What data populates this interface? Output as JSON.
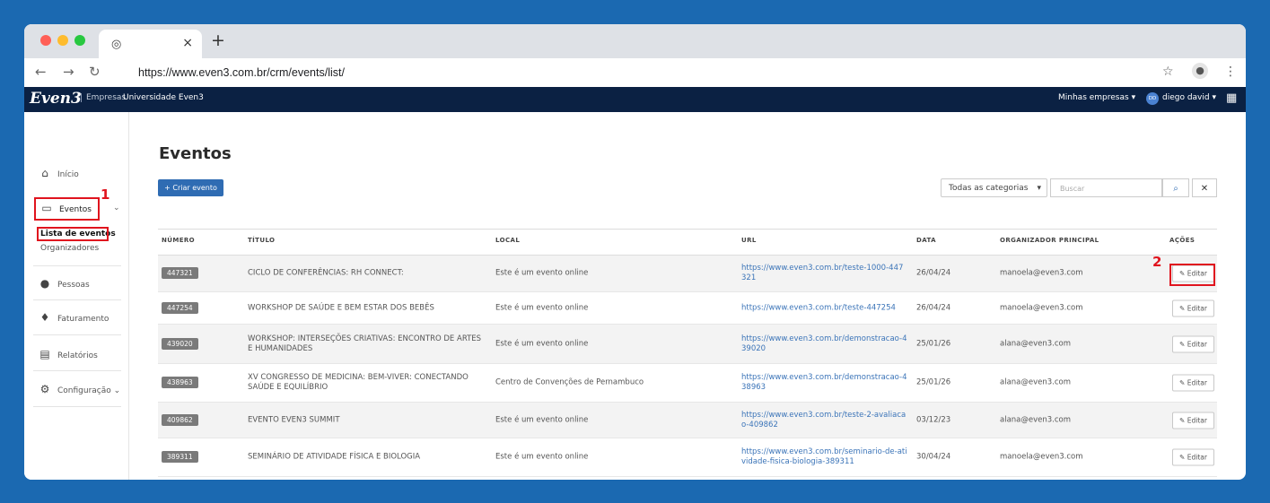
{
  "browser": {
    "url": "https://www.even3.com.br/crm/events/list/",
    "tab_close": "×",
    "new_tab": "+"
  },
  "topnav": {
    "logo": "Even3",
    "section": "Empresas",
    "org": "Universidade Even3",
    "companies": "Minhas empresas",
    "user_initials": "DD",
    "user": "diego david"
  },
  "sidebar": {
    "inicio": "Início",
    "eventos": "Eventos",
    "lista": "Lista de eventos",
    "organizadores": "Organizadores",
    "pessoas": "Pessoas",
    "faturamento": "Faturamento",
    "relatorios": "Relatórios",
    "configuracao": "Configuração"
  },
  "markers": {
    "one": "1",
    "two": "2"
  },
  "main": {
    "title": "Eventos",
    "create_button": "+ Criar evento",
    "category_select": "Todas as categorias",
    "search_placeholder": "Buscar"
  },
  "table": {
    "headers": [
      "NÚMERO",
      "TÍTULO",
      "LOCAL",
      "URL",
      "DATA",
      "ORGANIZADOR PRINCIPAL",
      "AÇÕES"
    ],
    "edit_label": "Editar",
    "rows": [
      {
        "numero": "447321",
        "titulo": "CICLO DE CONFERÊNCIAS: RH CONNECT:",
        "local": "Este é um evento online",
        "url": "https://www.even3.com.br/teste-1000-447321",
        "data": "26/04/24",
        "organizador": "manoela@even3.com"
      },
      {
        "numero": "447254",
        "titulo": "WORKSHOP DE SAÚDE E BEM ESTAR DOS BEBÊS",
        "local": "Este é um evento online",
        "url": "https://www.even3.com.br/teste-447254",
        "data": "26/04/24",
        "organizador": "manoela@even3.com"
      },
      {
        "numero": "439020",
        "titulo": "WORKSHOP: INTERSEÇÕES CRIATIVAS: ENCONTRO DE ARTES E HUMANIDADES",
        "local": "Este é um evento online",
        "url": "https://www.even3.com.br/demonstracao-439020",
        "data": "25/01/26",
        "organizador": "alana@even3.com"
      },
      {
        "numero": "438963",
        "titulo": "XV CONGRESSO DE MEDICINA: BEM-VIVER: CONECTANDO SAÚDE E EQUILÍBRIO",
        "local": "Centro de Convenções de Pernambuco",
        "url": "https://www.even3.com.br/demonstracao-438963",
        "data": "25/01/26",
        "organizador": "alana@even3.com"
      },
      {
        "numero": "409862",
        "titulo": "EVENTO EVEN3 SUMMIT",
        "local": "Este é um evento online",
        "url": "https://www.even3.com.br/teste-2-avaliacao-409862",
        "data": "03/12/23",
        "organizador": "alana@even3.com"
      },
      {
        "numero": "389311",
        "titulo": "SEMINÁRIO DE ATIVIDADE FÍSICA E BIOLOGIA",
        "local": "Este é um evento online",
        "url": "https://www.even3.com.br/seminario-de-atividade-fisica-biologia-389311",
        "data": "30/04/24",
        "organizador": "manoela@even3.com"
      }
    ]
  }
}
